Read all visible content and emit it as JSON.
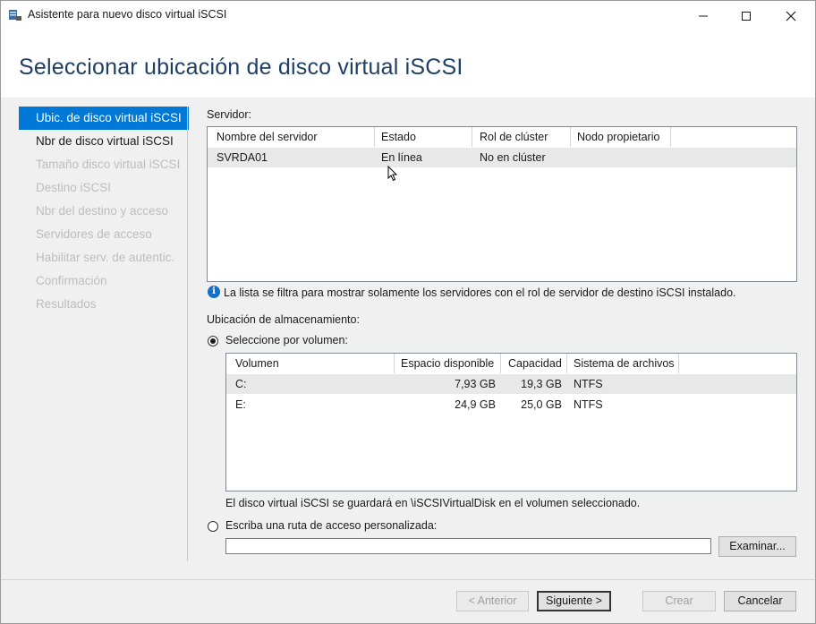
{
  "window": {
    "title": "Asistente para nuevo disco virtual iSCSI",
    "minimize_glyph": "—",
    "maximize_glyph": "☐",
    "close_glyph": "✕"
  },
  "page": {
    "title": "Seleccionar ubicación de disco virtual iSCSI"
  },
  "nav": {
    "items": [
      {
        "label": "Ubic. de disco virtual iSCSI",
        "state": "active"
      },
      {
        "label": "Nbr de disco virtual iSCSI",
        "state": "enabled"
      },
      {
        "label": "Tamaño disco virtual iSCSI",
        "state": "disabled"
      },
      {
        "label": "Destino iSCSI",
        "state": "disabled"
      },
      {
        "label": "Nbr del destino y acceso",
        "state": "disabled"
      },
      {
        "label": "Servidores de acceso",
        "state": "disabled"
      },
      {
        "label": "Habilitar serv. de autentic.",
        "state": "disabled"
      },
      {
        "label": "Confirmación",
        "state": "disabled"
      },
      {
        "label": "Resultados",
        "state": "disabled"
      }
    ]
  },
  "server_section": {
    "label": "Servidor:",
    "columns": [
      "Nombre del servidor",
      "Estado",
      "Rol de clúster",
      "Nodo propietario"
    ],
    "rows": [
      {
        "name": "SVRDA01",
        "status": "En línea",
        "cluster_role": "No en clúster",
        "owner_node": ""
      }
    ],
    "info_text": "La lista se filtra para mostrar solamente los servidores con el rol de servidor de destino iSCSI instalado."
  },
  "storage_section": {
    "label": "Ubicación de almacenamiento:",
    "by_volume_label": "Seleccione por volumen:",
    "volume_columns": [
      "Volumen",
      "Espacio disponible",
      "Capacidad",
      "Sistema de archivos"
    ],
    "volumes": [
      {
        "volume": "C:",
        "free": "7,93 GB",
        "capacity": "19,3 GB",
        "fs": "NTFS"
      },
      {
        "volume": "E:",
        "free": "24,9 GB",
        "capacity": "25,0 GB",
        "fs": "NTFS"
      }
    ],
    "save_note": "El disco virtual iSCSI se guardará en \\iSCSIVirtualDisk en el volumen seleccionado.",
    "custom_path_label": "Escriba una ruta de acceso personalizada:",
    "custom_path_value": "",
    "browse_label": "Examinar..."
  },
  "footer": {
    "previous_label": "< Anterior",
    "next_label": "Siguiente >",
    "create_label": "Crear",
    "cancel_label": "Cancelar"
  }
}
